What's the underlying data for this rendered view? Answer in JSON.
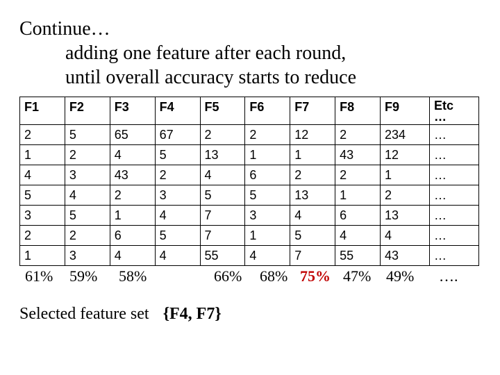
{
  "title": {
    "line1": "Continue…",
    "line2": "adding one feature after each round,",
    "line3": "until overall accuracy starts to reduce"
  },
  "headers": [
    "F1",
    "F2",
    "F3",
    "F4",
    "F5",
    "F6",
    "F7",
    "F8",
    "F9"
  ],
  "etc_header_top": "Etc",
  "etc_header_bot": "…",
  "chart_data": {
    "type": "table",
    "title": "Feature selection rounds",
    "columns": [
      "F1",
      "F2",
      "F3",
      "F4",
      "F5",
      "F6",
      "F7",
      "F8",
      "F9",
      "Etc"
    ],
    "rows": [
      {
        "F1": "2",
        "F2": "5",
        "F3": "65",
        "F4": "67",
        "F5": "2",
        "F6": "2",
        "F7": "12",
        "F8": "2",
        "F9": "234",
        "Etc": "…"
      },
      {
        "F1": "1",
        "F2": "2",
        "F3": "4",
        "F4": "5",
        "F5": "13",
        "F6": "1",
        "F7": "1",
        "F8": "43",
        "F9": "12",
        "Etc": "…"
      },
      {
        "F1": "4",
        "F2": "3",
        "F3": "43",
        "F4": "2",
        "F5": "4",
        "F6": "6",
        "F7": "2",
        "F8": "2",
        "F9": "1",
        "Etc": "…"
      },
      {
        "F1": "5",
        "F2": "4",
        "F3": "2",
        "F4": "3",
        "F5": "5",
        "F6": "5",
        "F7": "13",
        "F8": "1",
        "F9": "2",
        "Etc": "…"
      },
      {
        "F1": "3",
        "F2": "5",
        "F3": "1",
        "F4": "4",
        "F5": "7",
        "F6": "3",
        "F7": "4",
        "F8": "6",
        "F9": "13",
        "Etc": "…"
      },
      {
        "F1": "2",
        "F2": "2",
        "F3": "6",
        "F4": "5",
        "F5": "7",
        "F6": "1",
        "F7": "5",
        "F8": "4",
        "F9": "4",
        "Etc": "…"
      },
      {
        "F1": "1",
        "F2": "3",
        "F3": "4",
        "F4": "4",
        "F5": "55",
        "F6": "4",
        "F7": "7",
        "F8": "55",
        "F9": "43",
        "Etc": "…"
      }
    ],
    "accuracy": {
      "F1": "61%",
      "F2": "59%",
      "F3": "58%",
      "F4": "",
      "F5": "66%",
      "F6": "68%",
      "F7": "75%",
      "F8": "47%",
      "F9": "49%",
      "Etc": "…."
    },
    "highlight_column": "F7"
  },
  "selected_label": "Selected feature set",
  "selected_set": "{F4, F7}"
}
